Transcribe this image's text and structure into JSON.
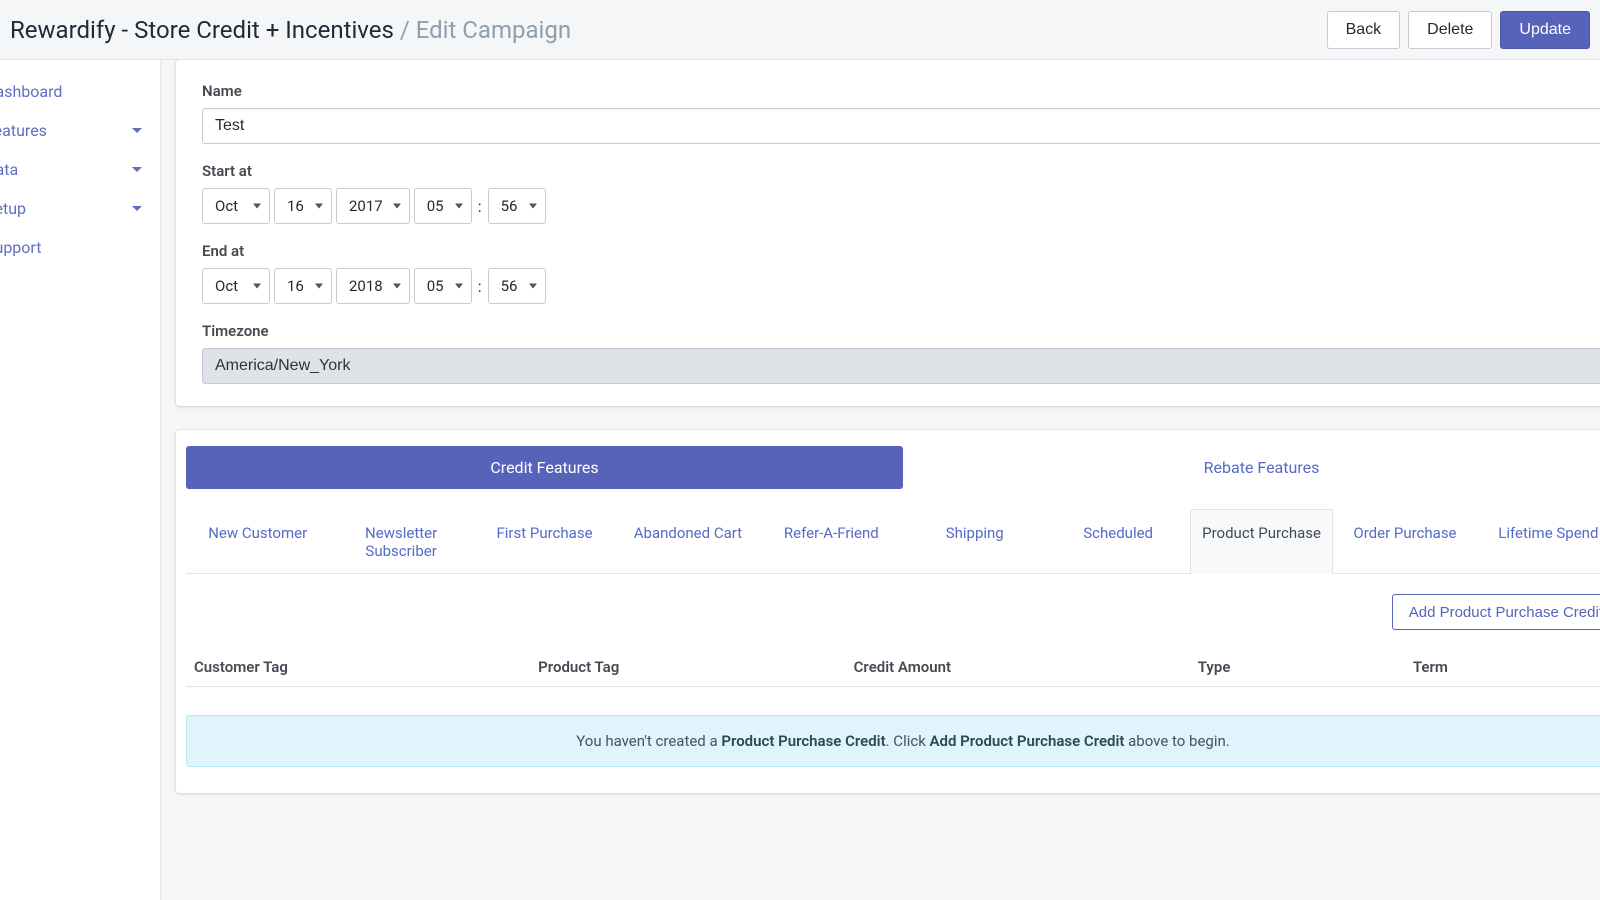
{
  "header": {
    "title_main": "Rewardify - Store Credit + Incentives",
    "title_sep": " / ",
    "title_crumb": "Edit Campaign",
    "back": "Back",
    "delete": "Delete",
    "update": "Update"
  },
  "sidebar": {
    "items": [
      {
        "label": "Dashboard",
        "caret": false
      },
      {
        "label": "Features",
        "caret": true
      },
      {
        "label": "Data",
        "caret": true
      },
      {
        "label": "Setup",
        "caret": true
      },
      {
        "label": "Support",
        "caret": false
      }
    ]
  },
  "form": {
    "name_label": "Name",
    "name_value": "Test",
    "start_label": "Start at",
    "end_label": "End at",
    "tz_label": "Timezone",
    "tz_value": "America/New_York",
    "start": {
      "month": "Oct",
      "day": "16",
      "year": "2017",
      "hour": "05",
      "min": "56"
    },
    "end": {
      "month": "Oct",
      "day": "16",
      "year": "2018",
      "hour": "05",
      "min": "56"
    }
  },
  "tabs_big": {
    "credit": "Credit Features",
    "rebate": "Rebate Features"
  },
  "subtabs": [
    "New Customer",
    "Newsletter Subscriber",
    "First Purchase",
    "Abandoned Cart",
    "Refer-A-Friend",
    "Shipping",
    "Scheduled",
    "Product Purchase",
    "Order Purchase",
    "Lifetime Spend"
  ],
  "subtab_active_index": 7,
  "add_button": "Add Product Purchase Credit",
  "table_headers": [
    "Customer Tag",
    "Product Tag",
    "Credit Amount",
    "Type",
    "Term"
  ],
  "empty_msg": {
    "pre": "You haven't created a ",
    "bold1": "Product Purchase Credit",
    "mid": ". Click ",
    "bold2": "Add Product Purchase Credit",
    "post": " above to begin."
  }
}
